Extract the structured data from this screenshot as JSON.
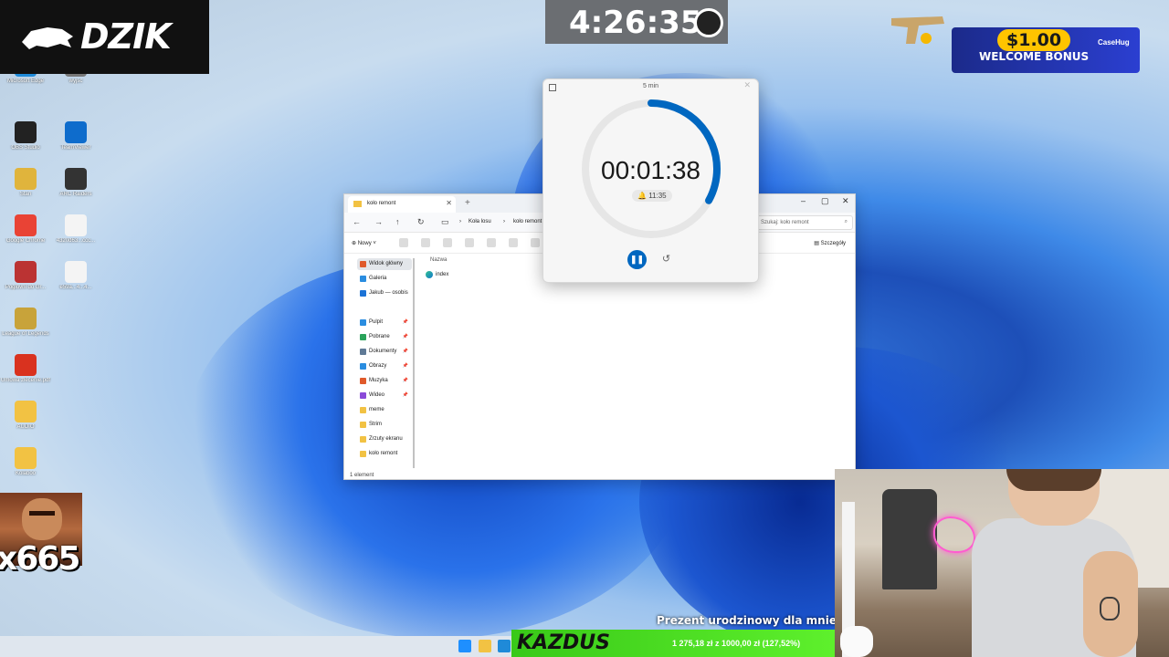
{
  "overlay": {
    "logo_text": "DZIK",
    "stream_clock": "4:26:35",
    "bonus_amount": "$1.00",
    "bonus_label": "WELCOME BONUS",
    "bonus_brand": "CaseHug",
    "emote_count": "x665",
    "goal_title": "Prezent urodzinowy dla mnie",
    "goal_name": "KAZDUS",
    "goal_amount": "1 275,18 zł z 1000,00 zł (127,52%)",
    "goal_progress": 1.0
  },
  "desktop": {
    "icons": [
      {
        "label": "Microsoft Edge",
        "color": "#1f8ad8"
      },
      {
        "label": "wyjsc",
        "color": "#777777"
      },
      {
        "label": "OBS Studio",
        "color": "#222222"
      },
      {
        "label": "TeamViewer",
        "color": "#0e6ccc"
      },
      {
        "label": "Stan",
        "color": "#e0b43c"
      },
      {
        "label": "ARC Raiders",
        "color": "#333333"
      },
      {
        "label": "Google Chrome",
        "color": "#e94335"
      },
      {
        "label": "4320d63...ccc...",
        "color": "#f4f4f4"
      },
      {
        "label": "Poglovni do Gr...",
        "color": "#bb3333"
      },
      {
        "label": "e59a...4...4...",
        "color": "#f4f4f4"
      },
      {
        "label": "League of Legends",
        "color": "#c8a33a"
      },
      {
        "label": "Umowa zlecenie.pdf",
        "color": "#d9321f"
      },
      {
        "label": "AUDIO",
        "color": "#f2c243"
      },
      {
        "label": "Kolaboo",
        "color": "#f2c243"
      },
      {
        "label": "Among Us",
        "color": "#c31c1c"
      }
    ]
  },
  "timer": {
    "title": "5 min",
    "time": "00:01:38",
    "alarm": "11:35",
    "progress_remaining": 0.33,
    "accent": "#0067c0"
  },
  "explorer": {
    "tab_label": "koło remont",
    "breadcrumb": [
      "Koła losu",
      "koło remont"
    ],
    "search_placeholder": "Szukaj: koło remont",
    "new_label": "Nowy",
    "details_label": "Szczegóły",
    "sidebar": [
      {
        "label": "Widok główny",
        "color": "#e05a2b",
        "pinned": false
      },
      {
        "label": "Galeria",
        "color": "#2a8de0",
        "pinned": false
      },
      {
        "label": "Jakub — osobis",
        "color": "#1c73d6",
        "pinned": false
      },
      {
        "label": "Pulpit",
        "color": "#2a8de0",
        "pinned": true
      },
      {
        "label": "Pobrane",
        "color": "#2aa35a",
        "pinned": true
      },
      {
        "label": "Dokumenty",
        "color": "#5f7a96",
        "pinned": true
      },
      {
        "label": "Obrazy",
        "color": "#2a8de0",
        "pinned": true
      },
      {
        "label": "Muzyka",
        "color": "#e05a2b",
        "pinned": true
      },
      {
        "label": "Wideo",
        "color": "#8a4ad8",
        "pinned": true
      },
      {
        "label": "meme",
        "color": "#f2c243",
        "pinned": false
      },
      {
        "label": "Strim",
        "color": "#f2c243",
        "pinned": false
      },
      {
        "label": "Zrzuty ekranu",
        "color": "#f2c243",
        "pinned": false
      },
      {
        "label": "koło remont",
        "color": "#f2c243",
        "pinned": false
      }
    ],
    "column_name": "Nazwa",
    "files": [
      {
        "label": "index"
      }
    ],
    "status": "1 element"
  }
}
